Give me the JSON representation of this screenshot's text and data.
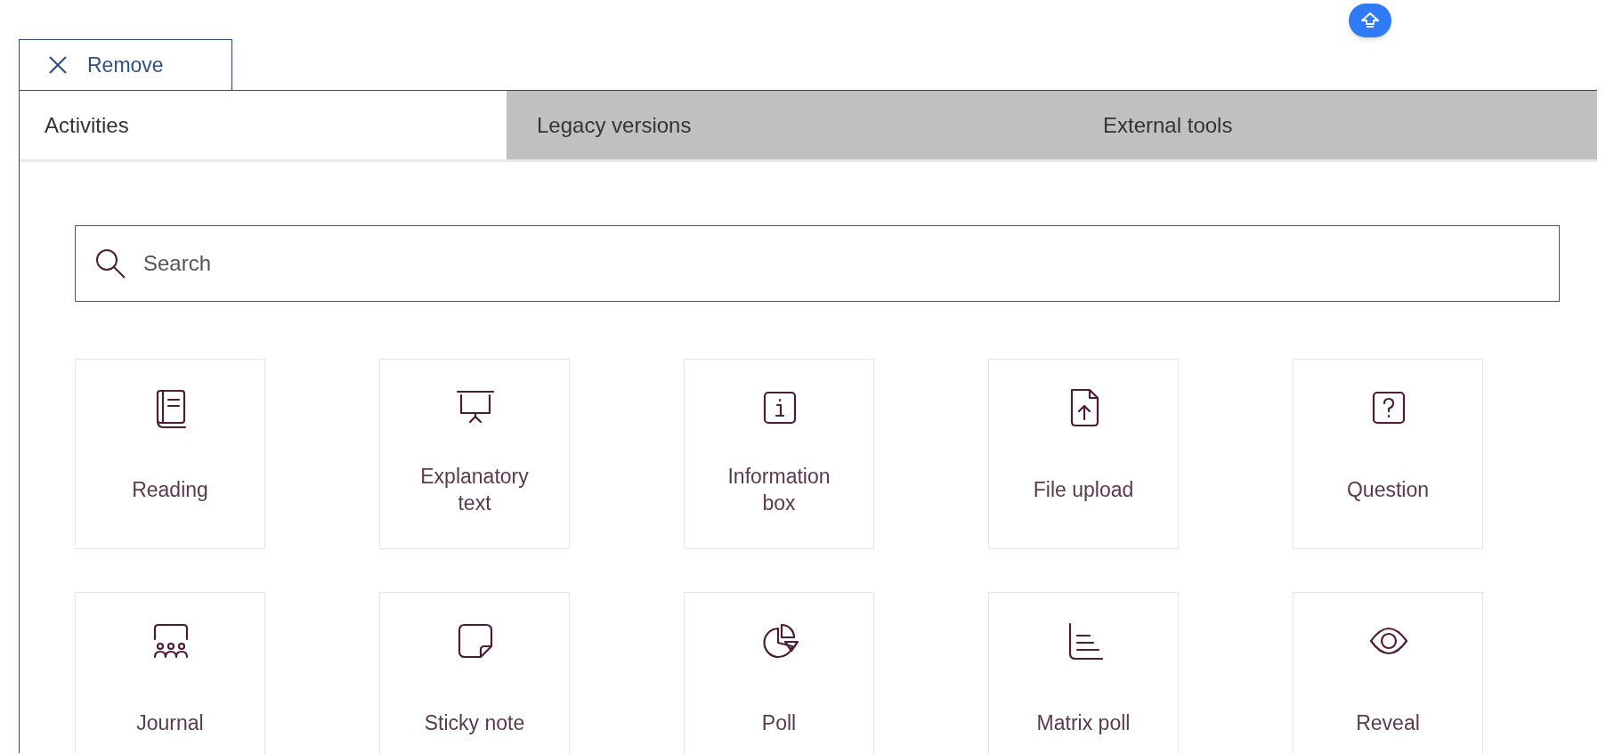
{
  "remove_button": {
    "label": "Remove"
  },
  "tabs": [
    {
      "label": "Activities",
      "selected": true
    },
    {
      "label": "Legacy versions",
      "selected": false
    },
    {
      "label": "External tools",
      "selected": false
    }
  ],
  "search": {
    "placeholder": "Search"
  },
  "activities": [
    {
      "label": "Reading"
    },
    {
      "label": "Explanatory text"
    },
    {
      "label": "Information box"
    },
    {
      "label": "File upload"
    },
    {
      "label": "Question"
    },
    {
      "label": "Journal"
    },
    {
      "label": "Sticky note"
    },
    {
      "label": "Poll"
    },
    {
      "label": "Matrix poll"
    },
    {
      "label": "Reveal"
    }
  ]
}
